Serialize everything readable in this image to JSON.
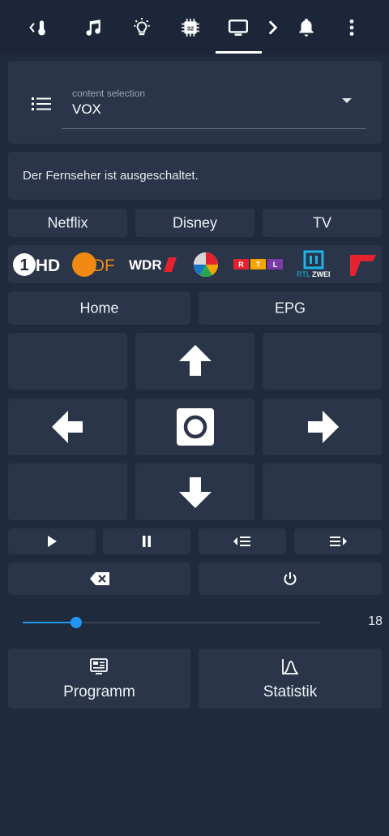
{
  "tabs": [
    {
      "name": "thermometer"
    },
    {
      "name": "music"
    },
    {
      "name": "lightbulb"
    },
    {
      "name": "chip-32"
    },
    {
      "name": "television",
      "active": true
    },
    {
      "name": "notifications"
    }
  ],
  "select": {
    "label": "content selection",
    "value": "VOX"
  },
  "status": "Der Fernseher ist ausgeschaltet.",
  "sources": [
    "Netflix",
    "Disney",
    "TV"
  ],
  "channels": {
    "one_hd": "1HD",
    "zdf": "2DF",
    "wdr": "WDR",
    "rtl": [
      "R",
      "T",
      "L"
    ],
    "rtl2": {
      "line1": "RTL",
      "line2": "ZWEI"
    }
  },
  "nav": {
    "home": "Home",
    "epg": "EPG"
  },
  "volume": {
    "value": 18,
    "fraction": 0.18
  },
  "bottom": {
    "program": "Programm",
    "stats": "Statistik"
  },
  "colors": {
    "accent": "#2196f3",
    "card": "#2a3549",
    "background": "#1f2a3c"
  }
}
